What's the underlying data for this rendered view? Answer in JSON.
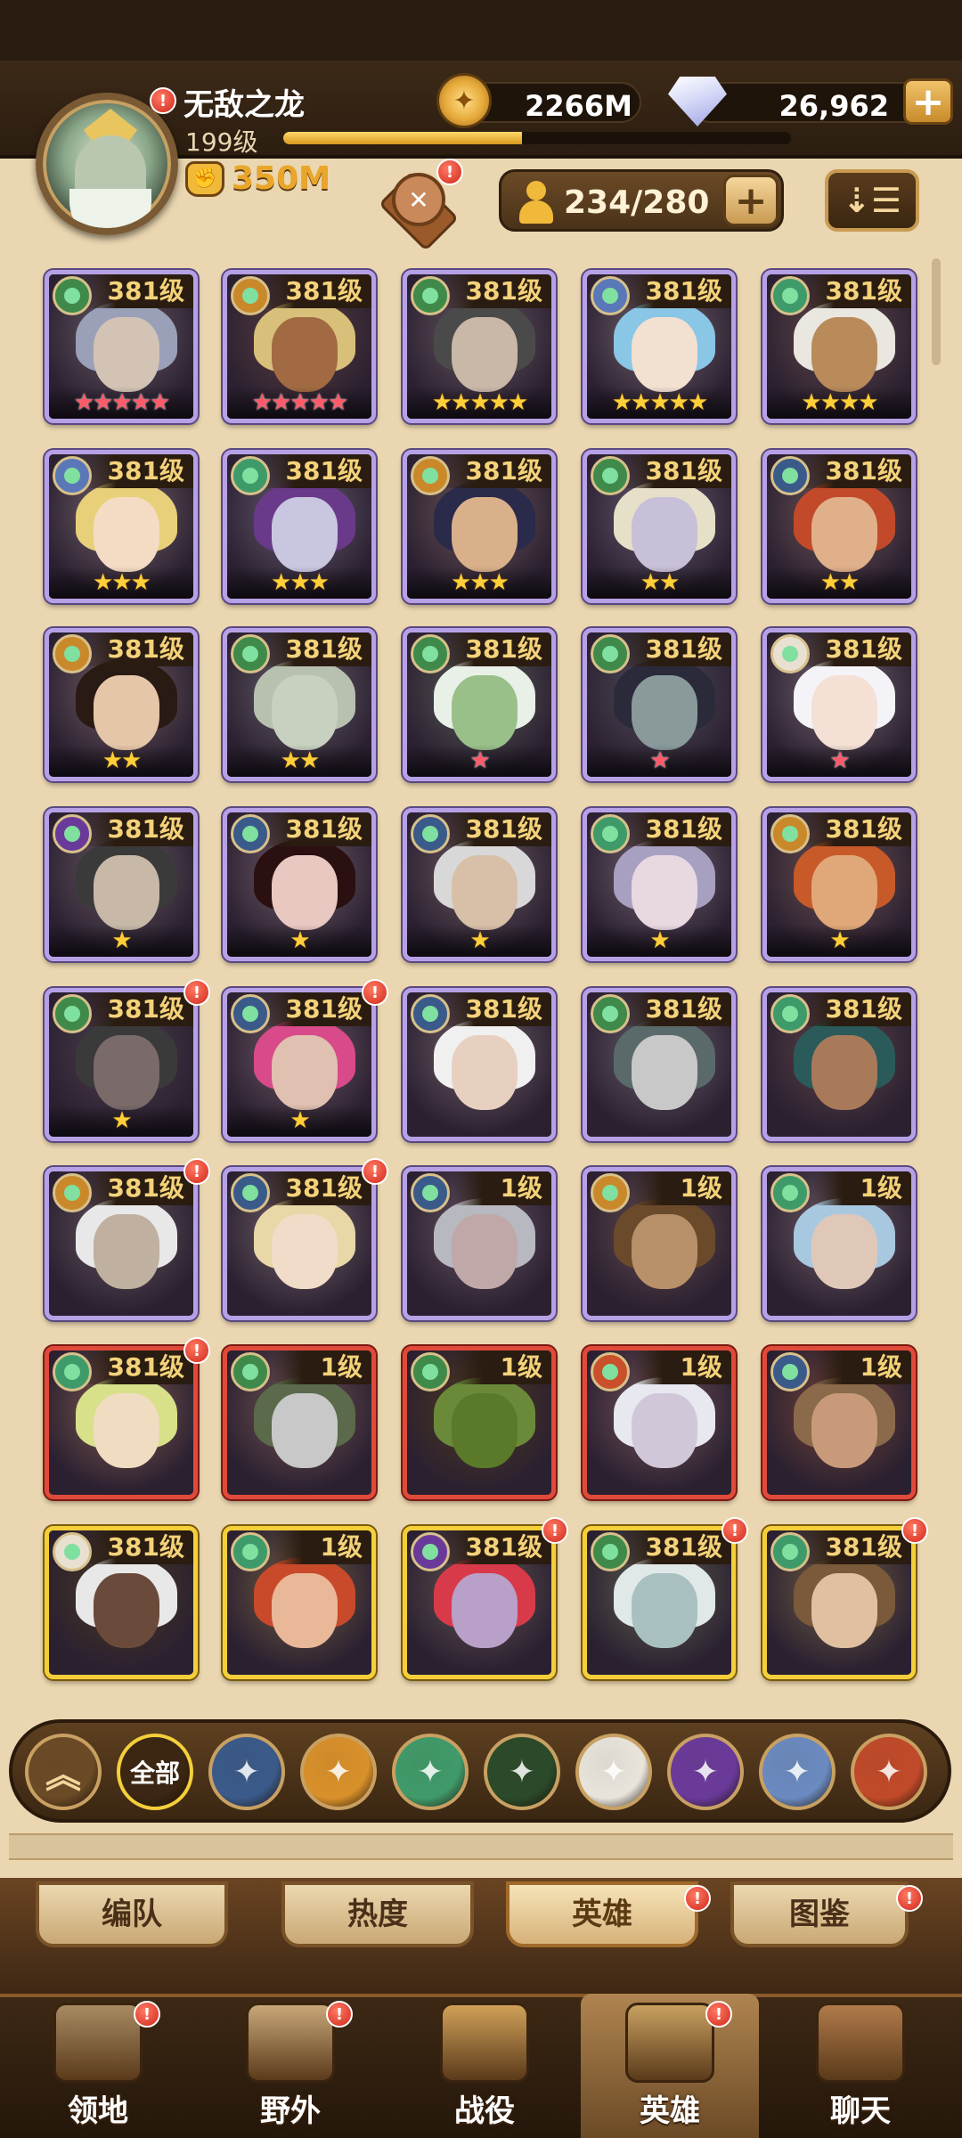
{
  "player": {
    "name": "无敌之龙",
    "level": "199级",
    "exp_progress": 0.47,
    "power": "350M"
  },
  "resources": {
    "gold": "2266M",
    "gems": "26,962",
    "plus_label": "+"
  },
  "roster": {
    "count": "234/280",
    "add_label": "+",
    "sort_icon": "sort-icon"
  },
  "badge_label": "!",
  "colors": {
    "accent": "#c99a52",
    "frame_purple": "#b7a1e6",
    "frame_red": "#e04a3a",
    "frame_gold": "#f4cf3a",
    "alert": "#d1281b"
  },
  "heroes": [
    {
      "level": "381级",
      "stars": "★★★★★",
      "star_color": "red",
      "frame": "purple",
      "faction": "#3f8a4a",
      "hair": "#9aa0b8",
      "skin": "#d2c3b4",
      "alert": false
    },
    {
      "level": "381级",
      "stars": "★★★★★",
      "star_color": "red",
      "frame": "purple",
      "faction": "#c9892a",
      "hair": "#d9c07a",
      "skin": "#a26a42",
      "alert": false
    },
    {
      "level": "381级",
      "stars": "★★★★★",
      "star_color": "gold",
      "frame": "purple",
      "faction": "#3f8a4a",
      "hair": "#4a4a4a",
      "skin": "#c9b8a8",
      "alert": false
    },
    {
      "level": "381级",
      "stars": "★★★★★",
      "star_color": "gold",
      "frame": "purple",
      "faction": "#5a78b8",
      "hair": "#8ac6e6",
      "skin": "#f2e0d0",
      "alert": false
    },
    {
      "level": "381级",
      "stars": "★★★★",
      "star_color": "gold",
      "frame": "purple",
      "faction": "#3f9a6a",
      "hair": "#eae6e0",
      "skin": "#b98a5a",
      "alert": false
    },
    {
      "level": "381级",
      "stars": "★★★",
      "star_color": "gold",
      "frame": "purple",
      "faction": "#5a78b8",
      "hair": "#e8d07a",
      "skin": "#f4dcc4",
      "alert": false
    },
    {
      "level": "381级",
      "stars": "★★★",
      "star_color": "gold",
      "frame": "purple",
      "faction": "#3f9a6a",
      "hair": "#6a3a8a",
      "skin": "#c9c6e0",
      "alert": false
    },
    {
      "level": "381级",
      "stars": "★★★",
      "star_color": "gold",
      "frame": "purple",
      "faction": "#c9892a",
      "hair": "#2a2a4a",
      "skin": "#d9b08a",
      "alert": false
    },
    {
      "level": "381级",
      "stars": "★★",
      "star_color": "gold",
      "frame": "purple",
      "faction": "#3f8a4a",
      "hair": "#e6e0c8",
      "skin": "#c8c0d8",
      "alert": false
    },
    {
      "level": "381级",
      "stars": "★★",
      "star_color": "gold",
      "frame": "purple",
      "faction": "#3a5a8a",
      "hair": "#c24a2a",
      "skin": "#e0b08a",
      "alert": false
    },
    {
      "level": "381级",
      "stars": "★★",
      "star_color": "gold",
      "frame": "purple",
      "faction": "#c9892a",
      "hair": "#2a1a14",
      "skin": "#e6c6a8",
      "alert": false
    },
    {
      "level": "381级",
      "stars": "★★",
      "star_color": "gold",
      "frame": "purple",
      "faction": "#3f8a4a",
      "hair": "#b8c0b0",
      "skin": "#c8d0c0",
      "alert": false
    },
    {
      "level": "381级",
      "stars": "★",
      "star_color": "red",
      "frame": "purple",
      "faction": "#3f8a4a",
      "hair": "#e8f0e8",
      "skin": "#9ac08a",
      "alert": false
    },
    {
      "level": "381级",
      "stars": "★",
      "star_color": "red",
      "frame": "purple",
      "faction": "#3f8a4a",
      "hair": "#2a2a3a",
      "skin": "#8a9a9a",
      "alert": false
    },
    {
      "level": "381级",
      "stars": "★",
      "star_color": "red",
      "frame": "purple",
      "faction": "#e8e0d0",
      "hair": "#f4f4f8",
      "skin": "#f4e0d4",
      "alert": false
    },
    {
      "level": "381级",
      "stars": "★",
      "star_color": "gold",
      "frame": "purple",
      "faction": "#6a3a9a",
      "hair": "#3a3a3a",
      "skin": "#c8b8a8",
      "alert": false
    },
    {
      "level": "381级",
      "stars": "★",
      "star_color": "gold",
      "frame": "purple",
      "faction": "#3a5a8a",
      "hair": "#2a1010",
      "skin": "#e8c8c0",
      "alert": false
    },
    {
      "level": "381级",
      "stars": "★",
      "star_color": "gold",
      "frame": "purple",
      "faction": "#3a5a8a",
      "hair": "#d8d8d8",
      "skin": "#d8c0a8",
      "alert": false
    },
    {
      "level": "381级",
      "stars": "★",
      "star_color": "gold",
      "frame": "purple",
      "faction": "#3f9a6a",
      "hair": "#a8a0c0",
      "skin": "#e8d8e0",
      "alert": false
    },
    {
      "level": "381级",
      "stars": "★",
      "star_color": "gold",
      "frame": "purple",
      "faction": "#c9892a",
      "hair": "#c85a2a",
      "skin": "#e0a878",
      "alert": false
    },
    {
      "level": "381级",
      "stars": "★",
      "star_color": "gold",
      "frame": "purple",
      "faction": "#3f8a4a",
      "hair": "#3a3a3a",
      "skin": "#7a6a6a",
      "alert": true
    },
    {
      "level": "381级",
      "stars": "★",
      "star_color": "gold",
      "frame": "purple",
      "faction": "#3a5a8a",
      "hair": "#d84a8a",
      "skin": "#e0c0b0",
      "alert": true
    },
    {
      "level": "381级",
      "stars": "",
      "star_color": "gold",
      "frame": "purple",
      "faction": "#3a5a8a",
      "hair": "#f0f0f0",
      "skin": "#e8d0c0",
      "alert": false
    },
    {
      "level": "381级",
      "stars": "",
      "star_color": "gold",
      "frame": "purple",
      "faction": "#3f8a4a",
      "hair": "#5a6a6a",
      "skin": "#c8c8c8",
      "alert": false
    },
    {
      "level": "381级",
      "stars": "",
      "star_color": "gold",
      "frame": "purple",
      "faction": "#3f9a6a",
      "hair": "#2a5a5a",
      "skin": "#a87a5a",
      "alert": false
    },
    {
      "level": "381级",
      "stars": "",
      "star_color": "gold",
      "frame": "purple",
      "faction": "#c9892a",
      "hair": "#e8e8e8",
      "skin": "#c0b0a0",
      "alert": true
    },
    {
      "level": "381级",
      "stars": "",
      "star_color": "gold",
      "frame": "purple",
      "faction": "#3a5a8a",
      "hair": "#e8d8a8",
      "skin": "#f0dcc8",
      "alert": true
    },
    {
      "level": "1级",
      "stars": "",
      "star_color": "gold",
      "frame": "purple",
      "faction": "#3a5a8a",
      "hair": "#b8b8c0",
      "skin": "#c0a8a8",
      "alert": false
    },
    {
      "level": "1级",
      "stars": "",
      "star_color": "gold",
      "frame": "purple",
      "faction": "#c9892a",
      "hair": "#6a4a2a",
      "skin": "#b8906a",
      "alert": false
    },
    {
      "level": "1级",
      "stars": "",
      "star_color": "gold",
      "frame": "purple",
      "faction": "#3f9a6a",
      "hair": "#a8c8e0",
      "skin": "#e0c8b8",
      "alert": false
    },
    {
      "level": "381级",
      "stars": "",
      "star_color": "gold",
      "frame": "red",
      "faction": "#3f9a6a",
      "hair": "#d8e08a",
      "skin": "#f0dcc0",
      "alert": true
    },
    {
      "level": "1级",
      "stars": "",
      "star_color": "gold",
      "frame": "red",
      "faction": "#3f8a4a",
      "hair": "#5a6a4a",
      "skin": "#c8c8c8",
      "alert": false
    },
    {
      "level": "1级",
      "stars": "",
      "star_color": "gold",
      "frame": "red",
      "faction": "#3f8a4a",
      "hair": "#6a8a3a",
      "skin": "#5a7a2a",
      "alert": false
    },
    {
      "level": "1级",
      "stars": "",
      "star_color": "gold",
      "frame": "red",
      "faction": "#c9502a",
      "hair": "#e8e8f0",
      "skin": "#d0c8d8",
      "alert": false
    },
    {
      "level": "1级",
      "stars": "",
      "star_color": "gold",
      "frame": "red",
      "faction": "#3a5a8a",
      "hair": "#8a6a4a",
      "skin": "#c89a7a",
      "alert": false
    },
    {
      "level": "381级",
      "stars": "",
      "star_color": "gold",
      "frame": "gold",
      "faction": "#e8e0d0",
      "hair": "#e8e8e8",
      "skin": "#6a4a3a",
      "alert": false
    },
    {
      "level": "1级",
      "stars": "",
      "star_color": "gold",
      "frame": "gold",
      "faction": "#3f9a6a",
      "hair": "#c84a2a",
      "skin": "#e8b898",
      "alert": false
    },
    {
      "level": "381级",
      "stars": "",
      "star_color": "gold",
      "frame": "gold",
      "faction": "#6a3a9a",
      "hair": "#d83a4a",
      "skin": "#b8a0c8",
      "alert": true
    },
    {
      "level": "381级",
      "stars": "",
      "star_color": "gold",
      "frame": "gold",
      "faction": "#3f8a4a",
      "hair": "#e0e8e8",
      "skin": "#a8c0c0",
      "alert": true
    },
    {
      "level": "381级",
      "stars": "",
      "star_color": "gold",
      "frame": "gold",
      "faction": "#3f9a6a",
      "hair": "#7a5a3a",
      "skin": "#e0c0a0",
      "alert": true
    }
  ],
  "filters": [
    {
      "name": "collapse-icon",
      "label": "",
      "bg": "#6b4a26"
    },
    {
      "name": "all-filter",
      "label": "全部",
      "bg": "#3a2612"
    },
    {
      "name": "lightbearer-icon",
      "label": "",
      "bg": "#3a5a8a"
    },
    {
      "name": "mauler-icon",
      "label": "",
      "bg": "#d8902a"
    },
    {
      "name": "wilder-icon",
      "label": "",
      "bg": "#3f9a6a"
    },
    {
      "name": "graveborn-icon",
      "label": "",
      "bg": "#2a4a2a"
    },
    {
      "name": "celestial-icon",
      "label": "",
      "bg": "#e8e4dc"
    },
    {
      "name": "hypogean-icon",
      "label": "",
      "bg": "#6a3a9a"
    },
    {
      "name": "dimensional-icon",
      "label": "",
      "bg": "#6a8ac0"
    },
    {
      "name": "draconis-icon",
      "label": "",
      "bg": "#c04a2a"
    }
  ],
  "subtabs": [
    {
      "label": "编队",
      "active": false,
      "alert": false
    },
    {
      "label": "热度",
      "active": false,
      "alert": false
    },
    {
      "label": "英雄",
      "active": true,
      "alert": true
    },
    {
      "label": "图鉴",
      "active": false,
      "alert": true
    }
  ],
  "nav": [
    {
      "label": "领地",
      "icon": "castle-icon",
      "active": false,
      "alert": true
    },
    {
      "label": "野外",
      "icon": "map-scroll-icon",
      "active": false,
      "alert": true
    },
    {
      "label": "战役",
      "icon": "sword-icon",
      "active": false,
      "alert": false
    },
    {
      "label": "英雄",
      "icon": "helmet-icon",
      "active": true,
      "alert": true
    },
    {
      "label": "聊天",
      "icon": "chat-icon",
      "active": false,
      "alert": false
    }
  ]
}
